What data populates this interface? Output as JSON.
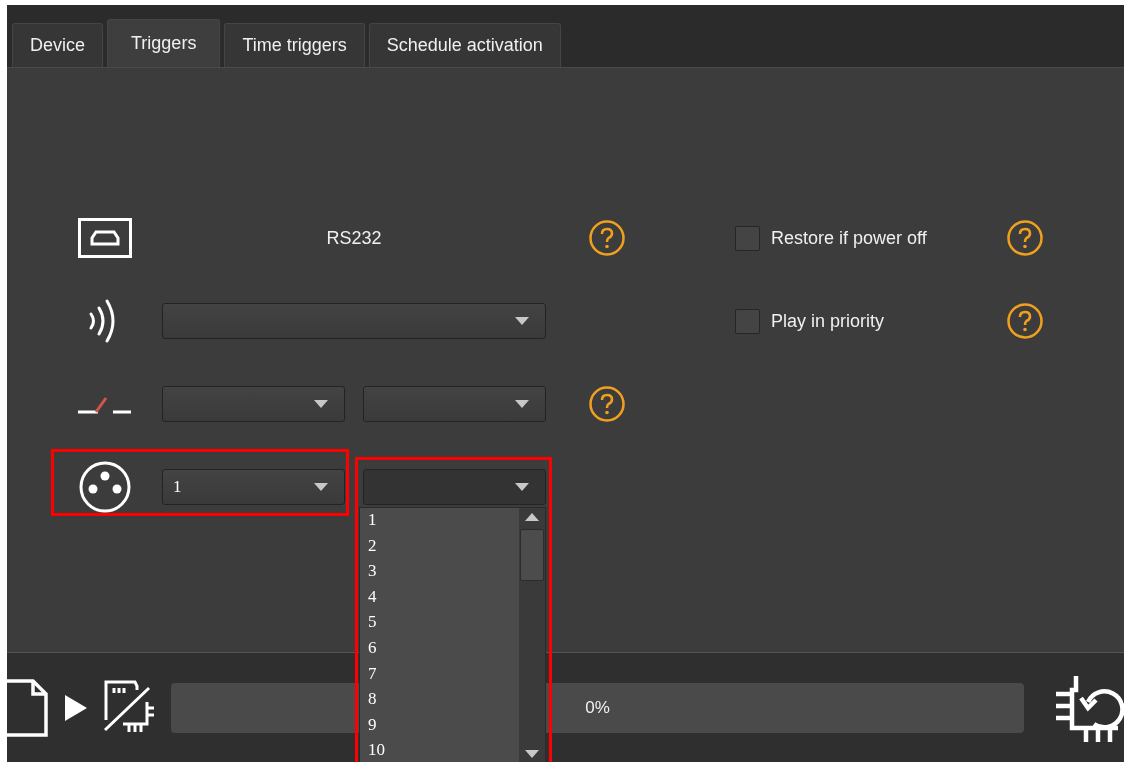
{
  "tabs": [
    {
      "label": "Device",
      "selected": false
    },
    {
      "label": "Triggers",
      "selected": true
    },
    {
      "label": "Time triggers",
      "selected": false
    },
    {
      "label": "Schedule activation",
      "selected": false
    }
  ],
  "triggers": [
    {
      "kind": "rs232",
      "text": "RS232",
      "help": true,
      "highlighted": false
    },
    {
      "kind": "wireless",
      "help": false,
      "highlighted": false,
      "dropdowns": [
        {
          "open": false,
          "highlighted": false
        }
      ]
    },
    {
      "kind": "switch",
      "help": true,
      "highlighted": false,
      "dropdowns": [
        {
          "open": false,
          "highlighted": false
        },
        {
          "open": false,
          "highlighted": false
        }
      ]
    },
    {
      "kind": "xlr",
      "help": false,
      "highlighted": true,
      "dropdowns": [
        {
          "value": "1",
          "open": false,
          "highlighted": false
        },
        {
          "open": true,
          "highlighted": true,
          "options": [
            "1",
            "2",
            "3",
            "4",
            "5",
            "6",
            "7",
            "8",
            "9",
            "10"
          ]
        }
      ]
    }
  ],
  "options": [
    {
      "label": "Restore if power off",
      "checked": false,
      "help": true
    },
    {
      "label": "Play in priority",
      "checked": false,
      "help": true
    }
  ],
  "progress": {
    "level": 0,
    "text": "0%"
  }
}
